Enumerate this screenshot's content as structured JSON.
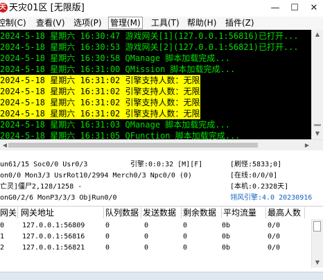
{
  "window": {
    "app_icon_text": "天",
    "title": "天灾01区 [无限版]",
    "minimize_glyph": "—",
    "maximize_glyph": "☐",
    "close_glyph": "✕"
  },
  "menu": [
    {
      "label": "控制(C)",
      "active": false
    },
    {
      "label": "查看(V)",
      "active": false
    },
    {
      "label": "选项(P)",
      "active": false
    },
    {
      "label": "管理(M)",
      "active": true
    },
    {
      "label": "工具(T)",
      "active": false
    },
    {
      "label": "帮助(H)",
      "active": false
    },
    {
      "label": "插件(Z)",
      "active": false
    }
  ],
  "log": {
    "text_color": "#00e000",
    "highlight_color": "#ffff00",
    "lines": [
      {
        "text": "2024-5-18 星期六 16:30:47 游戏网关[1](127.0.0.1:56816)已打开...",
        "highlight": false
      },
      {
        "text": "2024-5-18 星期六 16:30:53 游戏网关[2](127.0.0.1:56821)已打开...",
        "highlight": false
      },
      {
        "text": "2024-5-18 星期六 16:30:58 QManage 脚本加载完成...",
        "highlight": false
      },
      {
        "text": "2024-5-18 星期六 16:31:00 QMission 脚本加载完成...",
        "highlight": false
      },
      {
        "text": "2024-5-18 星期六 16:31:02 引擎支持人数：无限",
        "highlight": true
      },
      {
        "text": "2024-5-18 星期六 16:31:02 引擎支持人数：无限",
        "highlight": true
      },
      {
        "text": "2024-5-18 星期六 16:31:02 引擎支持人数：无限",
        "highlight": true
      },
      {
        "text": "2024-5-18 星期六 16:31:02 引擎支持人数：无限",
        "highlight": true
      },
      {
        "text": "2024-5-18 星期六 16:31:03 QManage 脚本加载完成...",
        "highlight": false
      },
      {
        "text": "2024-5-18 星期六 16:31:05 QFunction 脚本加载完成...",
        "highlight": false
      }
    ]
  },
  "status": {
    "row1_left": "un61/15 Soc0/0 Usr0/3",
    "row1_mid": "引擎:0:0:32 [M][F]",
    "row1_right": "[刷怪:5833;0]",
    "row2_left": "on0/0 Mon3/3 UsrRot10/2994 Merch0/3 Npc0/0 (0)",
    "row2_right": "[在线:0/0/0]",
    "row3_left": "亡灵]僵尸2,128/1258 -",
    "row3_right": "[本机:0.2328天]",
    "row4_left": "onG0/2/6 MonP3/3/3 ObjRun0/0",
    "row4_right": "翎风引擎:4.0 20230916"
  },
  "table": {
    "headers": [
      "网关",
      "网关地址",
      "队列数据",
      "发送数据",
      "剩余数据",
      "平均流量",
      "最高人数"
    ],
    "rows": [
      [
        "0",
        "127.0.0.1:56809",
        "0",
        "0",
        "0",
        "0b",
        "0/0"
      ],
      [
        "1",
        "127.0.0.1:56816",
        "0",
        "0",
        "0",
        "0b",
        "0/0"
      ],
      [
        "2",
        "127.0.0.1:56821",
        "0",
        "0",
        "0",
        "0b",
        "0/0"
      ]
    ]
  }
}
